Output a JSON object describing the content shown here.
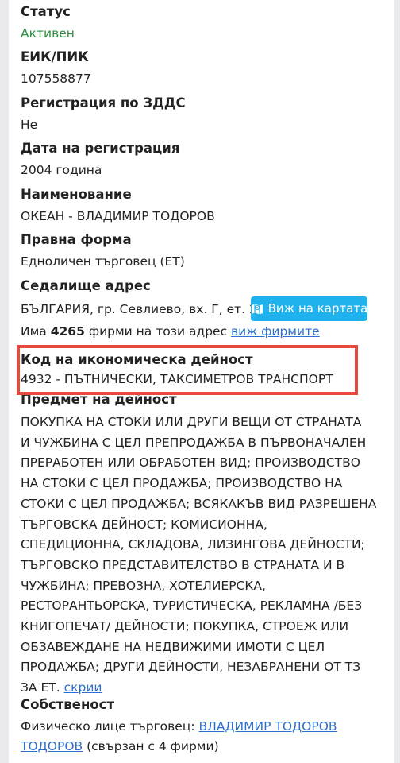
{
  "fields": {
    "status": {
      "label": "Статус",
      "value": "Активен"
    },
    "eik": {
      "label": "ЕИК/ПИК",
      "value": "107558877"
    },
    "vat": {
      "label": "Регистрация по ЗДДС",
      "value": "Не"
    },
    "reg_date": {
      "label": "Дата на регистрация",
      "value": "2004 година"
    },
    "name": {
      "label": "Наименование",
      "value": "ОКЕАН - ВЛАДИМИР ТОДОРОВ"
    },
    "legal_form": {
      "label": "Правна форма",
      "value": "Едноличен търговец (ЕТ)"
    },
    "address": {
      "label": "Седалище адрес",
      "value": "БЪЛГАРИЯ, гр. Севлиево, вх. Г, ет. 2",
      "map_button": "Виж на картата",
      "companies_prefix": "Има",
      "companies_count": "4265",
      "companies_suffix": "фирми на този адрес",
      "companies_link": "виж фирмите"
    },
    "activity_code": {
      "label": "Код на икономическа дейност",
      "value": "4932 - ПЪТНИЧЕСКИ, ТАКСИМЕТРОВ ТРАНСПОРТ"
    },
    "subject": {
      "label": "Предмет на дейност",
      "lines": [
        "ПОКУПКА НА СТОКИ ИЛИ ДРУГИ ВЕЩИ ОТ СТРАНАТА",
        "И ЧУЖБИНА С ЦЕЛ ПРЕПРОДАЖБА В ПЪРВОНАЧАЛЕН",
        "ПРЕРАБОТЕН ИЛИ ОБРАБОТЕН ВИД; ПРОИЗВОДСТВО",
        "НА СТОКИ С ЦЕЛ ПРОДАЖБА; ПРОИЗВОДСТВО НА",
        "СТОКИ С ЦЕЛ ПРОДАЖБА; ВСЯКАКЪВ ВИД РАЗРЕШЕНА",
        "ТЪРГОВСКА ДЕЙНОСТ; КОМИСИОННА,",
        "СПЕДИЦИОННА, СКЛАДОВА, ЛИЗИНГОВА ДЕЙНОСТИ;",
        "ТЪРГОВСКО ПРЕДСТАВИТЕЛСТВО В СТРАНАТА И В",
        "ЧУЖБИНА; ПРЕВОЗНА, ХОТЕЛИЕРСКА,",
        "РЕСТОРАНТЬОРСКА, ТУРИСТИЧЕСКА, РЕКЛАМНА /БЕЗ",
        "КНИГОПЕЧАТ/ ДЕЙНОСТИ; ПОКУПКА, СТРОЕЖ ИЛИ",
        "ОБЗАВЕЖДАНЕ НА НЕДВИЖИМИ ИМОТИ С ЦЕЛ",
        "ПРОДАЖБА; ДРУГИ ДЕЙНОСТИ, НЕЗАБРАНЕНИ ОТ ТЗ"
      ],
      "last_line_text": "ЗА ЕТ.",
      "hide_link": "скрии"
    },
    "ownership": {
      "label": "Собственост",
      "prefix": "Физическо лице търговец:",
      "owner_name_1": "ВЛАДИМИР ТОДОРОВ",
      "owner_name_2": "ТОДОРОВ",
      "suffix": "(свързан с 4 фирми)"
    }
  },
  "colors": {
    "status_green": "#2e9142",
    "link_blue": "#2f6fd0",
    "button_blue": "#1fb2ec",
    "highlight_red": "#e64a3e"
  },
  "icons": {
    "map_button_icon": "map-icon"
  }
}
